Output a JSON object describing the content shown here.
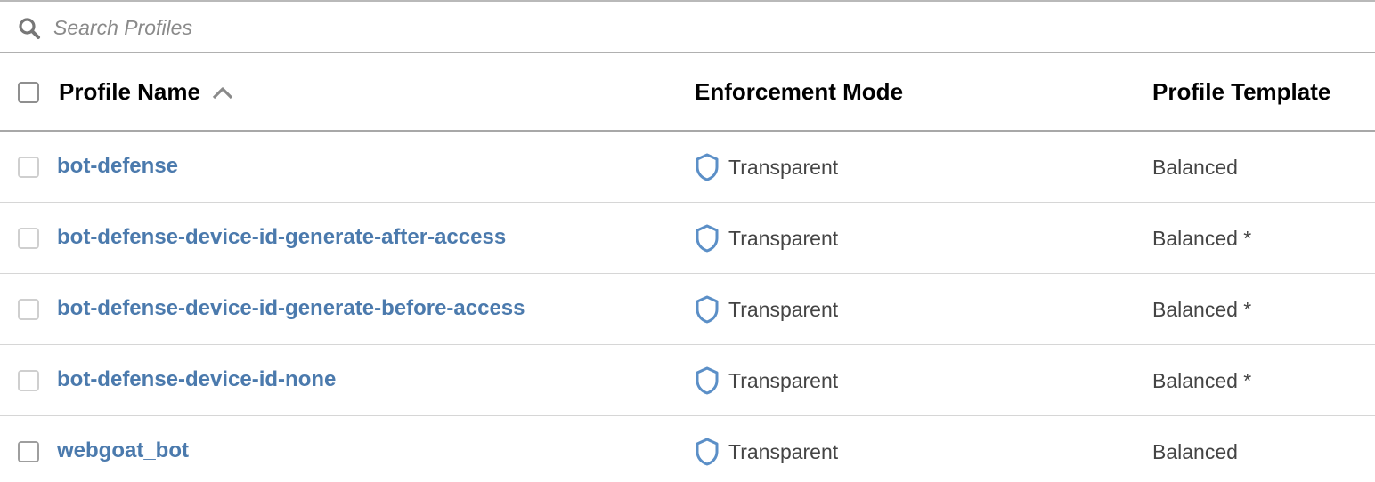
{
  "search": {
    "placeholder": "Search Profiles",
    "value": ""
  },
  "table": {
    "headers": {
      "name": "Profile Name",
      "mode": "Enforcement Mode",
      "template": "Profile Template"
    },
    "sort": {
      "column": "name",
      "direction": "ascending"
    },
    "rows": [
      {
        "name": "bot-defense",
        "mode": "Transparent",
        "template": "Balanced"
      },
      {
        "name": "bot-defense-device-id-generate-after-access",
        "mode": "Transparent",
        "template": "Balanced *"
      },
      {
        "name": "bot-defense-device-id-generate-before-access",
        "mode": "Transparent",
        "template": "Balanced *"
      },
      {
        "name": "bot-defense-device-id-none",
        "mode": "Transparent",
        "template": "Balanced *"
      },
      {
        "name": "webgoat_bot",
        "mode": "Transparent",
        "template": "Balanced"
      }
    ]
  },
  "icons": {
    "search": "search-icon",
    "sort": "chevron-up-icon",
    "mode": "shield-icon"
  },
  "colors": {
    "link": "#4b7aad",
    "shield": "#5b8fc7"
  }
}
